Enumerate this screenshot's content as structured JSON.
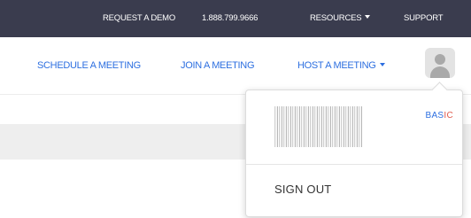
{
  "topbar": {
    "request_demo": "REQUEST A DEMO",
    "phone": "1.888.799.9666",
    "resources": "RESOURCES",
    "support": "SUPPORT"
  },
  "nav": {
    "schedule": "SCHEDULE A MEETING",
    "join": "JOIN A MEETING",
    "host": "HOST A MEETING"
  },
  "account_menu": {
    "plan_prefix": "BAS",
    "plan_suffix": "IC",
    "sign_out": "SIGN OUT"
  },
  "colors": {
    "topbar_bg": "#3a3c4e",
    "link_blue": "#2d6fe0",
    "accent_red": "#e05a4c"
  }
}
